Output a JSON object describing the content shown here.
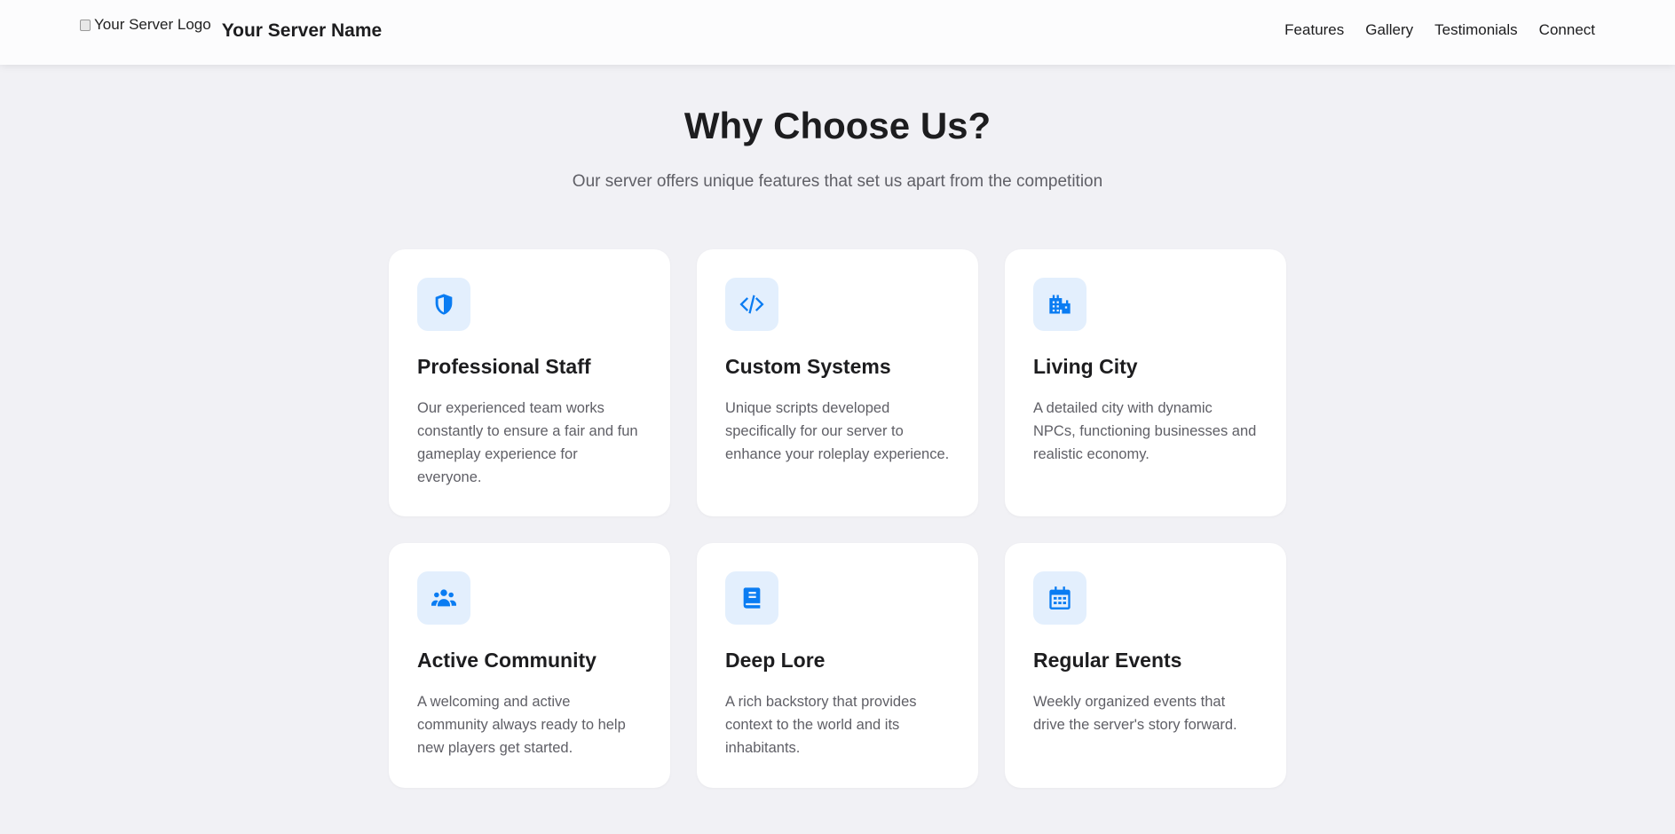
{
  "header": {
    "logo_alt": "Your Server Logo",
    "site_name": "Your Server Name",
    "nav": [
      "Features",
      "Gallery",
      "Testimonials",
      "Connect"
    ]
  },
  "section": {
    "title": "Why Choose Us?",
    "subtitle": "Our server offers unique features that set us apart from the competition"
  },
  "features": [
    {
      "icon": "shield-icon",
      "title": "Professional Staff",
      "text": "Our experienced team works constantly to ensure a fair and fun gameplay experience for everyone."
    },
    {
      "icon": "code-icon",
      "title": "Custom Systems",
      "text": "Unique scripts developed specifically for our server to enhance your roleplay experience."
    },
    {
      "icon": "city-icon",
      "title": "Living City",
      "text": "A detailed city with dynamic NPCs, functioning businesses and realistic economy."
    },
    {
      "icon": "users-icon",
      "title": "Active Community",
      "text": "A welcoming and active community always ready to help new players get started."
    },
    {
      "icon": "book-icon",
      "title": "Deep Lore",
      "text": "A rich backstory that provides context to the world and its inhabitants."
    },
    {
      "icon": "calendar-icon",
      "title": "Regular Events",
      "text": "Weekly organized events that drive the server's story forward."
    }
  ],
  "colors": {
    "accent": "#0a7cf2",
    "icon_bg": "#e3effd",
    "page_bg": "#f1f1f5"
  }
}
